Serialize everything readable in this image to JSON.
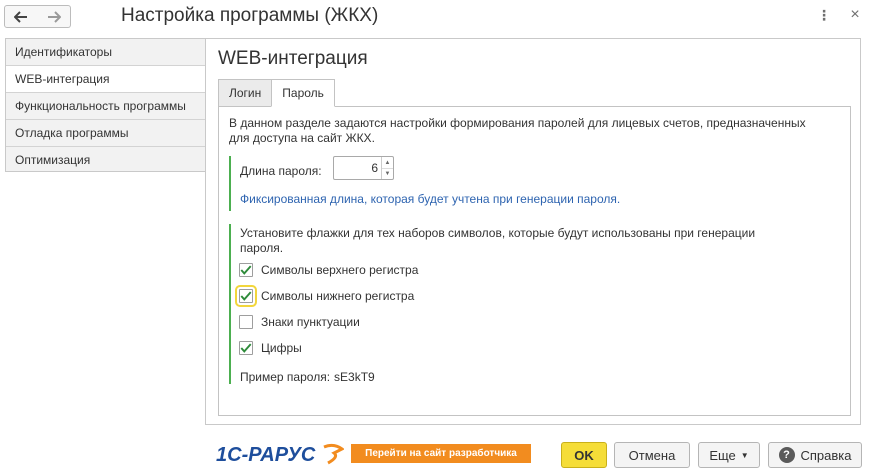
{
  "window": {
    "title": "Настройка программы (ЖКХ)",
    "back_icon": "arrow-left-icon",
    "forward_icon": "arrow-right-icon",
    "menu_icon": "more-vertical-icon",
    "close_icon": "close-icon"
  },
  "sidebar": {
    "items": [
      {
        "label": "Идентификаторы",
        "active": false
      },
      {
        "label": "WEB-интеграция",
        "active": true
      },
      {
        "label": "Функциональность программы",
        "active": false
      },
      {
        "label": "Отладка программы",
        "active": false
      },
      {
        "label": "Оптимизация",
        "active": false
      }
    ]
  },
  "main": {
    "title": "WEB-интеграция",
    "tabs": [
      {
        "label": "Логин",
        "active": false
      },
      {
        "label": "Пароль",
        "active": true
      }
    ],
    "intro": "В данном разделе задаются настройки формирования паролей для лицевых счетов, предназначенных для доступа на сайт ЖКХ.",
    "password_length": {
      "label": "Длина пароля:",
      "value": "6",
      "hint": "Фиксированная длина, которая будет учтена при генерации пароля."
    },
    "charsets": {
      "intro": "Установите флажки для тех наборов символов, которые будут использованы при генерации пароля.",
      "options": [
        {
          "label": "Символы верхнего регистра",
          "checked": true
        },
        {
          "label": "Символы нижнего регистра",
          "checked": true
        },
        {
          "label": "Знаки пунктуации",
          "checked": false
        },
        {
          "label": "Цифры",
          "checked": true
        }
      ]
    },
    "sample": {
      "label": "Пример пароля:",
      "value": "sE3kT9"
    }
  },
  "footer": {
    "logo_text": "1С-РАРУС",
    "dev_link": "Перейти на сайт разработчика",
    "ok": "OK",
    "cancel": "Отмена",
    "more": "Еще",
    "help": "Справка",
    "help_icon": "question-icon"
  },
  "colors": {
    "accent_green": "#4caf50",
    "hint_blue": "#2e64b0",
    "ok_yellow": "#f5dd38",
    "link_orange": "#f28c1f",
    "logo_blue": "#1e4e9c",
    "logo_orange": "#f28c1f"
  }
}
